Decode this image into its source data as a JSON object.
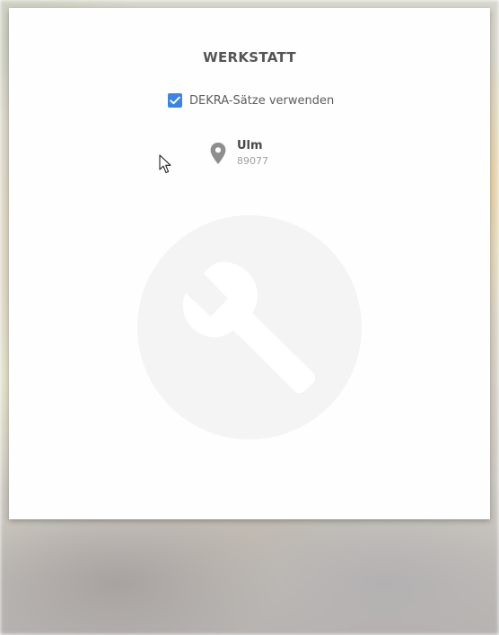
{
  "window": {
    "background": "blurred-photo"
  },
  "card": {
    "title": "WERKSTATT",
    "dekra_checkbox": {
      "label": "DEKRA-Sätze verwenden",
      "checked": true,
      "color": "#3c84e0"
    },
    "location": {
      "icon": "map-pin-icon",
      "city": "Ulm",
      "zip": "89077"
    },
    "watermark_icon": "wrench-icon"
  },
  "cursor": {
    "icon": "mouse-pointer-icon"
  }
}
